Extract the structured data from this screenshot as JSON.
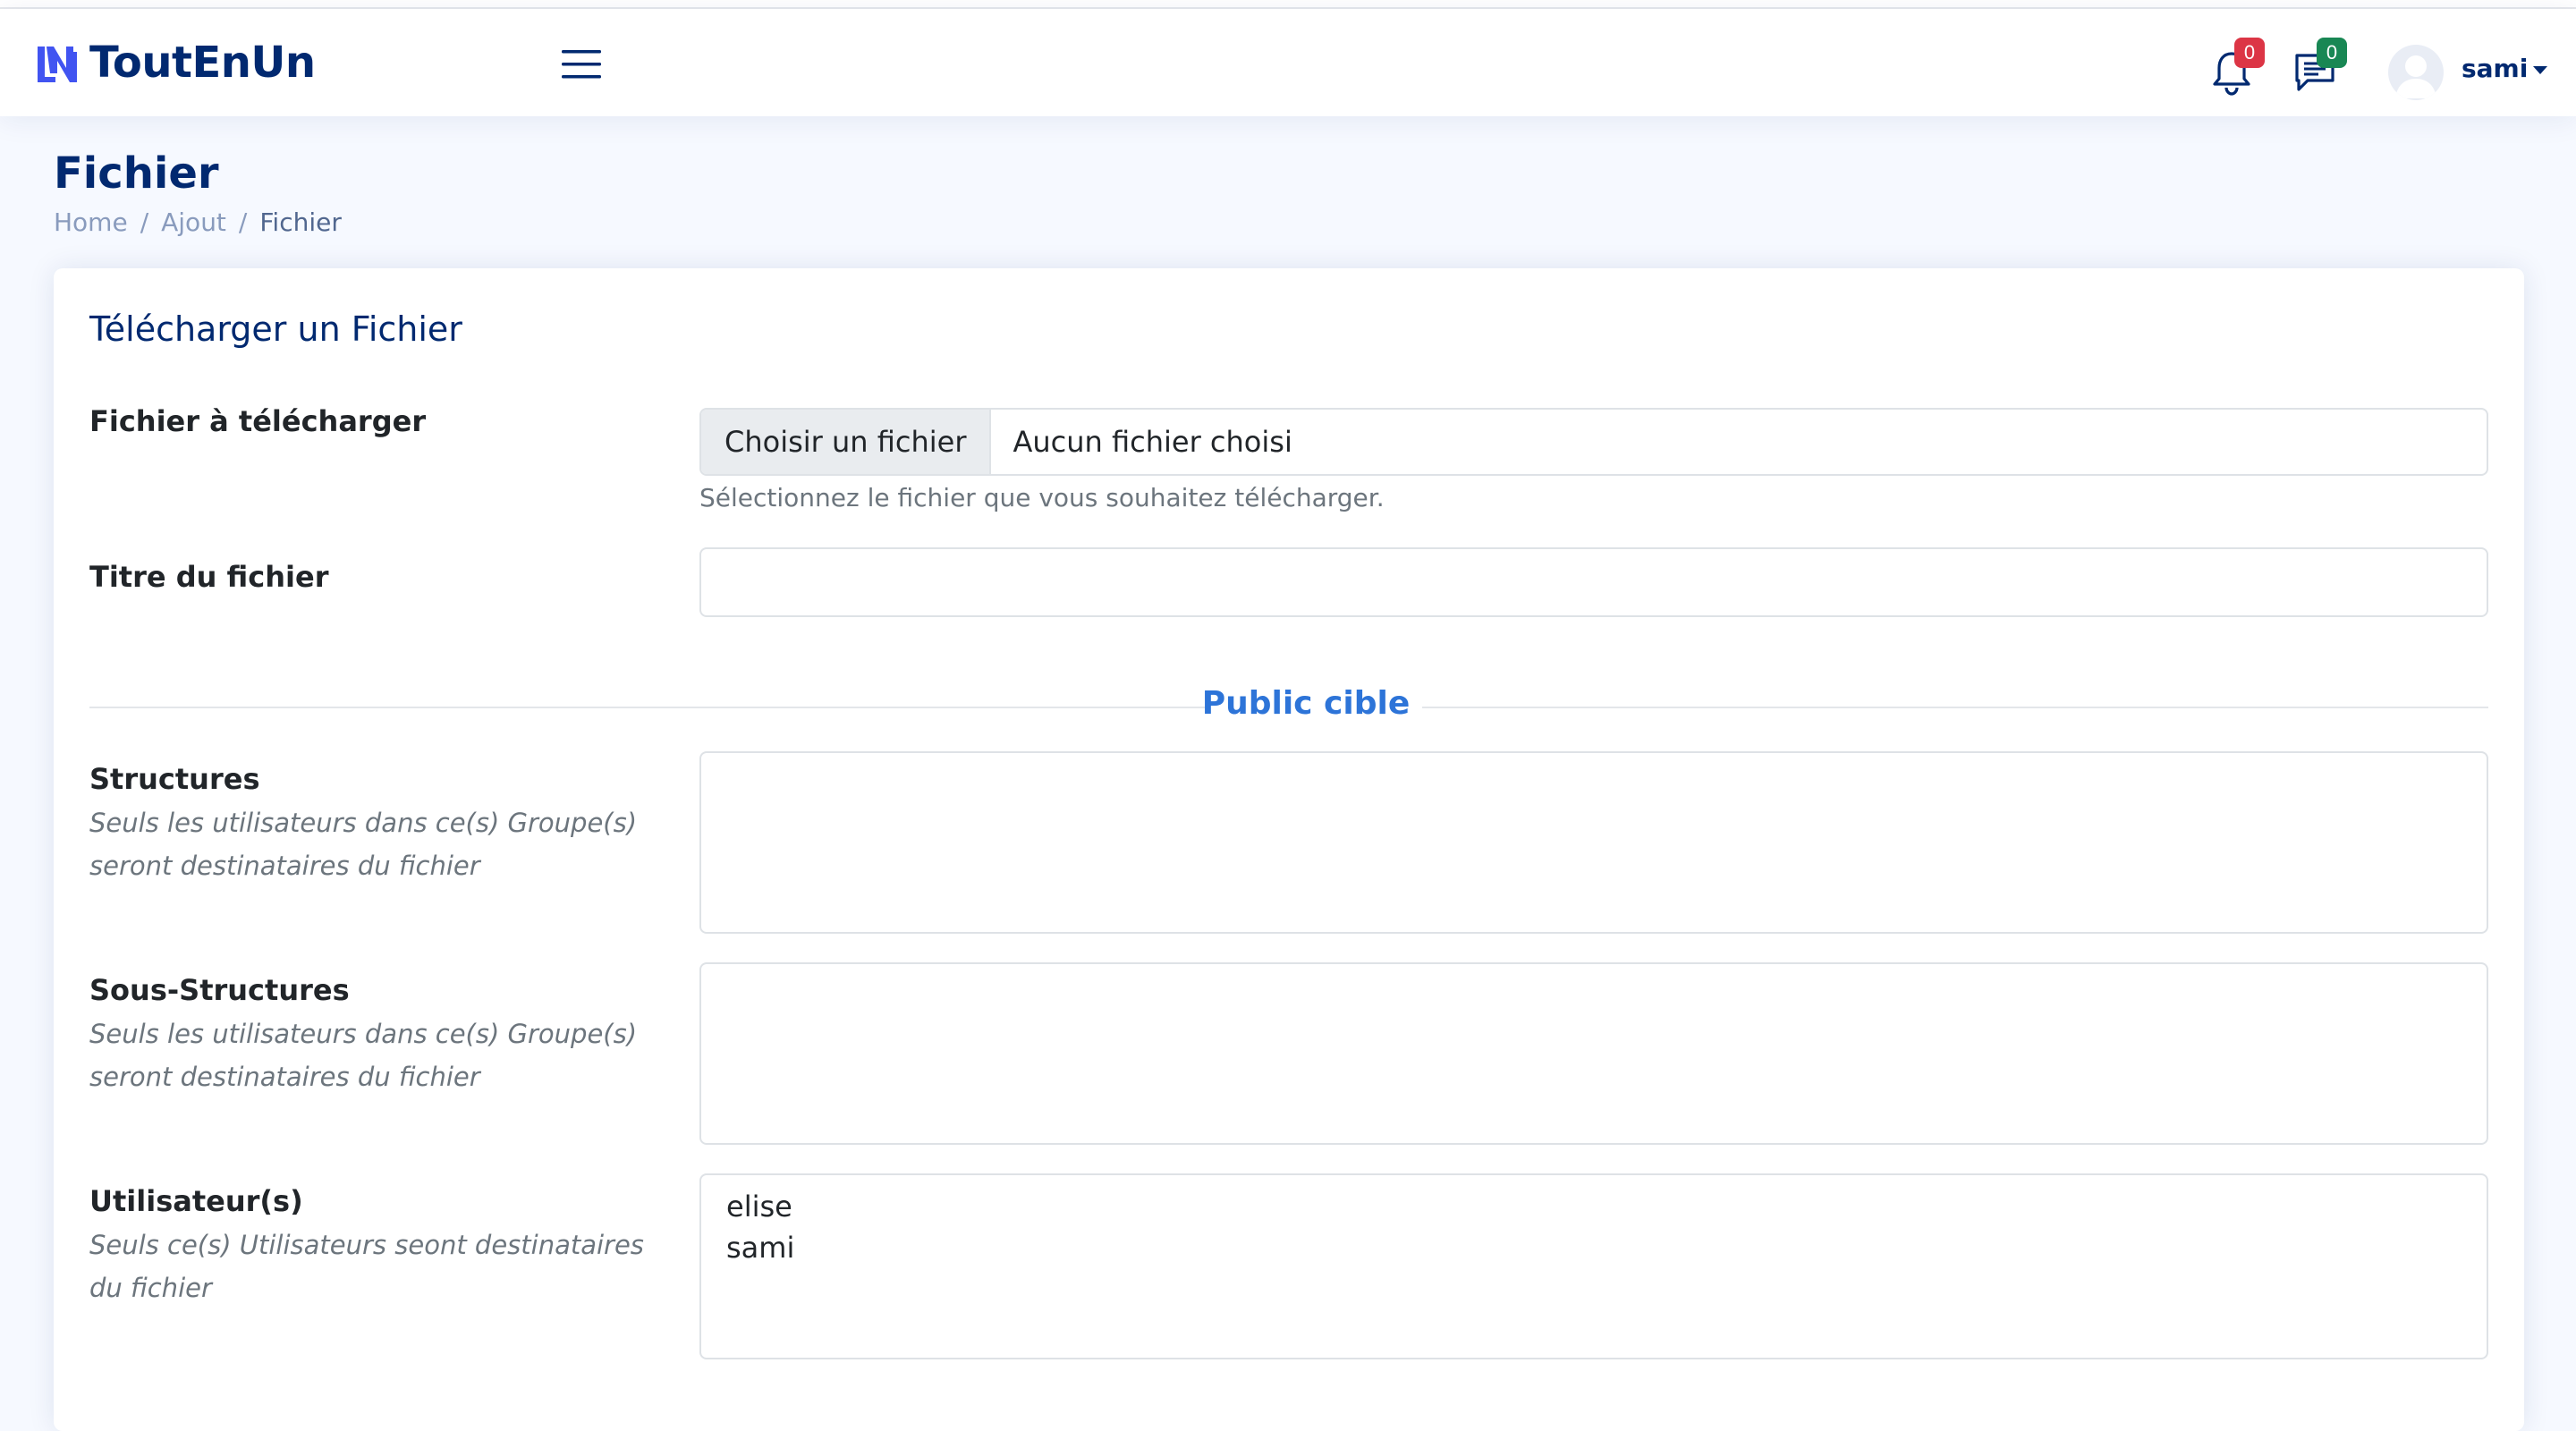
{
  "app": {
    "name": "ToutEnUn"
  },
  "header": {
    "notifications_count": "0",
    "messages_count": "0",
    "user_name": "sami"
  },
  "page": {
    "title": "Fichier",
    "breadcrumb": [
      "Home",
      "Ajout",
      "Fichier"
    ]
  },
  "card": {
    "title": "Télécharger un Fichier",
    "file_field": {
      "label": "Fichier à télécharger",
      "button_label": "Choisir un fichier",
      "status": "Aucun fichier choisi",
      "help": "Sélectionnez le fichier que vous souhaitez télécharger."
    },
    "title_field": {
      "label": "Titre du fichier",
      "value": ""
    },
    "divider": "Public cible",
    "structures": {
      "label": "Structures",
      "help": "Seuls les utilisateurs dans ce(s) Groupe(s) seront destinataires du fichier",
      "options": []
    },
    "sous_structures": {
      "label": "Sous-Structures",
      "help": "Seuls les utilisateurs dans ce(s) Groupe(s) seront destinataires du fichier",
      "options": []
    },
    "utilisateurs": {
      "label": "Utilisateur(s)",
      "help": "Seuls ce(s) Utilisateurs seont destinataires du fichier",
      "options": [
        "elise",
        "sami"
      ]
    }
  },
  "colors": {
    "brand": "#012970",
    "accent": "#4154f1",
    "divider_label": "#2d74d8",
    "badge_notifications": "#dc3545",
    "badge_messages": "#198754"
  },
  "icons": {
    "menu": "hamburger-icon",
    "notifications": "bell-icon",
    "messages": "chat-icon",
    "profile": "avatar-icon"
  }
}
